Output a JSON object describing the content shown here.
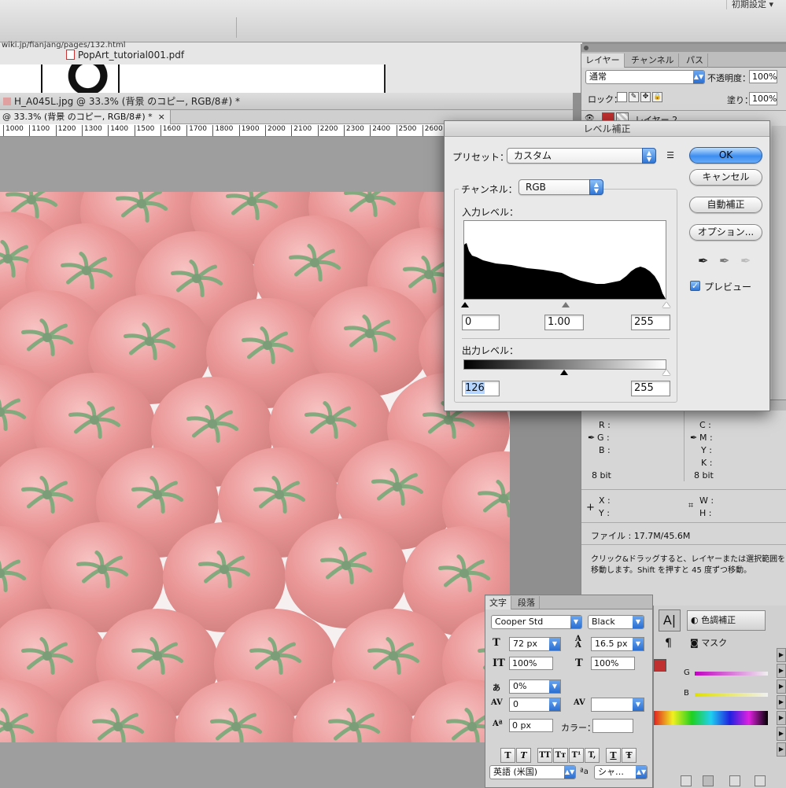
{
  "topbar": {
    "workspace": "初期設定 ▾"
  },
  "browser": {
    "url": "wiki.jp/fianjang/pages/132.html",
    "tab": "PopArt_tutorial001.pdf"
  },
  "doc1": {
    "title": "H_A045L.jpg @ 33.3% (背景 のコピー, RGB/8#) *"
  },
  "doc2": {
    "tab": "@ 33.3% (背景 のコピー, RGB/8#) *",
    "close": "×"
  },
  "ruler": [
    "1000",
    "1100",
    "1200",
    "1300",
    "1400",
    "1500",
    "1600",
    "1700",
    "1800",
    "1900",
    "2000",
    "2100",
    "2200",
    "2300",
    "2400",
    "2500",
    "2600"
  ],
  "layers": {
    "tabs": [
      "レイヤー",
      "チャンネル",
      "パス"
    ],
    "blend_mode": "通常",
    "opacity_label": "不透明度：",
    "opacity": "100%",
    "lock_label": "ロック：",
    "fill_label": "塗り：",
    "fill": "100%",
    "layer_name": "レイヤー 2"
  },
  "info": {
    "r": "R :",
    "g": "G :",
    "b": "B :",
    "c": "C :",
    "m": "M :",
    "y": "Y :",
    "k": "K :",
    "bits_left": "8 bit",
    "bits_right": "8 bit",
    "x": "X :",
    "yy": "Y :",
    "w": "W :",
    "h": "H :",
    "file": "ファイル : 17.7M/45.6M",
    "hint1": "クリック&ドラッグすると、レイヤーまたは選択範囲を",
    "hint2": "移動します。Shift を押すと 45 度ずつ移動。"
  },
  "levels": {
    "title": "レベル補正",
    "preset_label": "プリセット：",
    "preset": "カスタム",
    "channel_label": "チャンネル：",
    "channel": "RGB",
    "input_label": "入力レベル：",
    "input_black": "0",
    "input_gamma": "1.00",
    "input_white": "255",
    "output_label": "出力レベル：",
    "output_black": "126",
    "output_white": "255",
    "ok": "OK",
    "cancel": "キャンセル",
    "auto": "自動補正",
    "options": "オプション...",
    "preview": "プレビュー"
  },
  "character": {
    "tabs": [
      "文字",
      "段落"
    ],
    "font": "Cooper Std",
    "style": "Black",
    "size": "72 px",
    "leading": "16.5 px",
    "vscale": "100%",
    "hscale": "100%",
    "tracking": "0%",
    "kerning": "0",
    "baseline": "0 px",
    "color_label": "カラー：",
    "language": "英語 (米国)",
    "aa": "シャ…",
    "style_buttons": [
      "T",
      "T",
      "TT",
      "Tт",
      "T¹",
      "T,",
      "T",
      "Ŧ"
    ]
  },
  "adjustments": {
    "tone": "色調補正",
    "mask": "マスク",
    "g": "G",
    "b": "B"
  },
  "colors": {
    "accent": "#3d8ef0",
    "tomato": "#d9534f"
  }
}
